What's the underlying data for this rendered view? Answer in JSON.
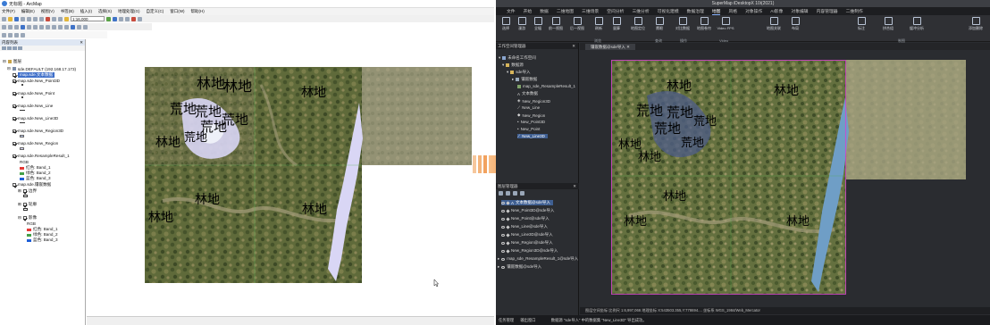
{
  "arcmap": {
    "title": "无标题 - ArcMap",
    "menu": [
      "文件(F)",
      "编辑(E)",
      "视图(V)",
      "书签(B)",
      "插入(I)",
      "选择(S)",
      "地理处理(G)",
      "自定义(C)",
      "窗口(W)",
      "帮助(H)"
    ],
    "scale_value": "1:16,000",
    "toc": {
      "title": "内容列表",
      "root": "图层",
      "datasource": "sde.DEFAULT (192.168.17.173)",
      "layers": [
        {
          "label": "map.sde.文本数据",
          "selected": true
        },
        {
          "label": "map.sde.New_Point3D"
        },
        {
          "label": "map.sde.New_Point"
        },
        {
          "label": "map.sde.New_Line"
        },
        {
          "label": "map.sde.New_Line3D"
        },
        {
          "label": "map.sde.New_Region3D"
        },
        {
          "label": "map.sde.New_Region"
        },
        {
          "label": "map.sde.ResampleResult_1"
        }
      ],
      "raster_bands_title": "RGB",
      "bands": [
        {
          "label": "红色: Band_1",
          "color": "#e53935"
        },
        {
          "label": "绿色: Band_2",
          "color": "#43a047"
        },
        {
          "label": "蓝色: Band_3",
          "color": "#1e5fd8"
        }
      ],
      "mosaic": "map.sde.镶嵌数据",
      "mosaic_children": [
        "边界",
        "轮廓",
        "影像"
      ],
      "mosaic_bands_title": "RGB",
      "mosaic_bands": [
        {
          "label": "红色: Band_1",
          "color": "#e53935"
        },
        {
          "label": "绿色: Band_2",
          "color": "#43a047"
        },
        {
          "label": "蓝色: Band_3",
          "color": "#1e5fd8"
        }
      ]
    },
    "map_labels": [
      {
        "text": "林地",
        "size": 16
      },
      {
        "text": "林地",
        "size": 16
      },
      {
        "text": "荒地",
        "size": 15
      },
      {
        "text": "荒地",
        "size": 15
      },
      {
        "text": "荒地",
        "size": 15
      },
      {
        "text": "荒地",
        "size": 15
      },
      {
        "text": "林地",
        "size": 14
      },
      {
        "text": "林地",
        "size": 14
      },
      {
        "text": "林地",
        "size": 14
      },
      {
        "text": "林地",
        "size": 14
      },
      {
        "text": "林地",
        "size": 14
      },
      {
        "text": "荒地",
        "size": 13
      },
      {
        "text": "林地",
        "size": 13
      }
    ]
  },
  "supermap": {
    "title": "SuperMap iDesktopX 10i(2021)",
    "tabs": [
      "文件",
      "开始",
      "数据",
      "二维地图",
      "三维场景",
      "空间分析",
      "三维分析",
      "可视化建模",
      "数据治理",
      "地图",
      "风格",
      "对象操作",
      "AI影像",
      "对象编辑",
      "内容管理器",
      "二维制作"
    ],
    "active_tab": "地图",
    "ribbon_buttons": [
      "选择",
      "漫游",
      "全幅",
      "前一视图",
      "后一视图",
      "刷新",
      "量算",
      "地图定位",
      "鹰眼",
      "对比数据",
      "地图卷帘",
      "Video FPS",
      "地图关联",
      "布局",
      "标注",
      "拼合组",
      "缓冲分析",
      "添加删除"
    ],
    "ribbon_groups": [
      "浏览",
      "操作",
      "查询",
      "Video",
      "制图"
    ],
    "workspace_title": "工作空间管理器",
    "workspace_items": [
      "未命名工作空间",
      "数据源",
      "sde导入",
      "镶嵌数据",
      "map_sde_ResampleResult_1",
      "文本数据",
      "New_Region3D",
      "New_Line",
      "New_Region",
      "New_Point3D",
      "New_Point",
      "New_Line3D"
    ],
    "layer_title": "图层管理器",
    "layer_items": [
      "文本数据@sde导入",
      "New_Point3D@sde导入",
      "New_Point@sde导入",
      "New_Line@sde导入",
      "New_Line3D@sde导入",
      "New_Region@sde导入",
      "New_Region3D@sde导入",
      "map_sde_ResampleResult_1@sde导入",
      "镶嵌数据@sde导入"
    ],
    "map_tab": "镶嵌数据@sde导入",
    "coords_line": "图层空间坐标 比例尺 1:6,997,066 地理坐标 X:543503.355,Y:778694.... 坐标系 WGS_1984/Web_Mercator",
    "status_line": "数据源 \"sde导入\" 中的数据集 \"New_Line3D\" 导出成功。",
    "status_tabs": [
      "任务管理",
      "输出窗口"
    ],
    "map_labels": [
      {
        "text": "林地",
        "size": 14
      },
      {
        "text": "林地",
        "size": 14
      },
      {
        "text": "荒地",
        "size": 15
      },
      {
        "text": "荒地",
        "size": 15
      },
      {
        "text": "荒地",
        "size": 15
      },
      {
        "text": "林地",
        "size": 13
      },
      {
        "text": "荒地",
        "size": 13
      },
      {
        "text": "林地",
        "size": 13
      },
      {
        "text": "荒地",
        "size": 13
      },
      {
        "text": "林地",
        "size": 13
      },
      {
        "text": "林地",
        "size": 13
      },
      {
        "text": "林地",
        "size": 13
      }
    ]
  },
  "colors": {
    "arrow": "#f08a34",
    "region_fill_arcmap": "#d9d6f5",
    "region_fill_supermap": "#6f9ec6",
    "supermap_bg": "#2a2c30",
    "map_border": "#d83dd3"
  }
}
